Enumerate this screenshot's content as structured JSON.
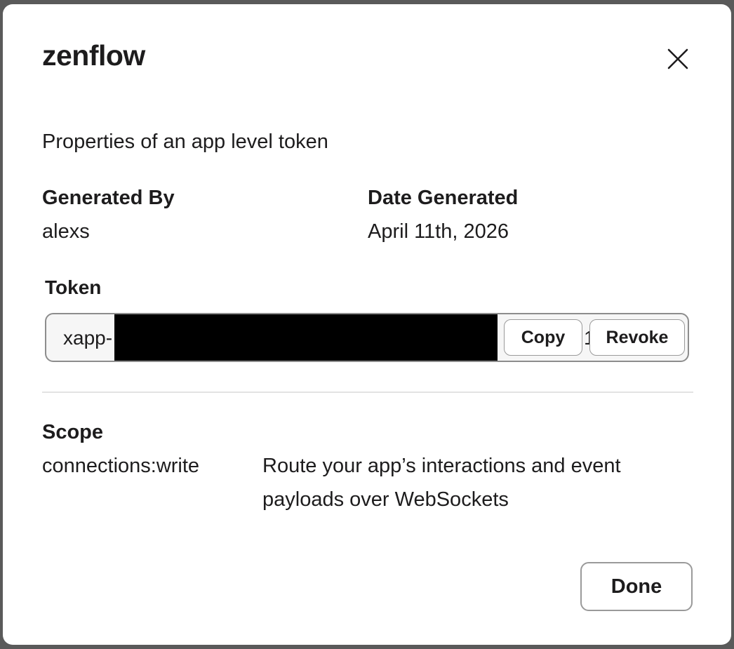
{
  "modal": {
    "title": "zenflow",
    "subtitle": "Properties of an app level token",
    "close_icon": "close-icon"
  },
  "generated_by": {
    "label": "Generated By",
    "value": "alexs"
  },
  "date_generated": {
    "label": "Date Generated",
    "value": "April 11th, 2026"
  },
  "token": {
    "label": "Token",
    "visible_prefix": "xapp-",
    "visible_suffix": "1",
    "copy_label": "Copy",
    "revoke_label": "Revoke"
  },
  "scope": {
    "label": "Scope",
    "items": [
      {
        "name": "connections:write",
        "description_line1": "Route your app’s interactions and event",
        "description_line2": "payloads over WebSockets"
      }
    ]
  },
  "footer": {
    "done_label": "Done"
  }
}
